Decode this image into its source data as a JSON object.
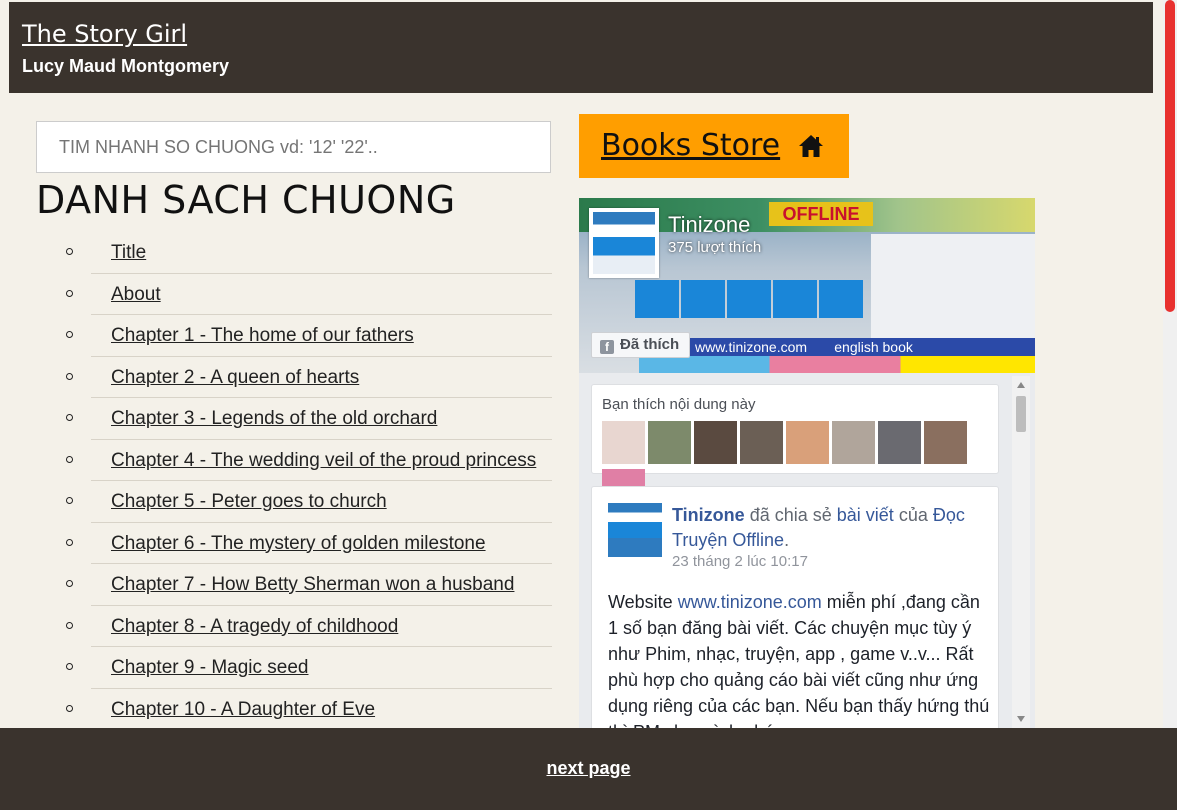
{
  "header": {
    "title": "The Story Girl",
    "author": "Lucy Maud Montgomery"
  },
  "search": {
    "placeholder": "TIM NHANH SO CHUONG vd: '12' '22'.."
  },
  "list": {
    "title": "DANH SACH CHUONG",
    "items": [
      "Title",
      "About",
      "Chapter 1 - The home of our fathers",
      "Chapter 2 - A queen of hearts",
      "Chapter 3 - Legends of the old orchard",
      "Chapter 4 - The wedding veil of the proud princess",
      "Chapter 5 - Peter goes to church",
      "Chapter 6 - The mystery of golden milestone",
      "Chapter 7 - How Betty Sherman won a husband",
      "Chapter 8 - A tragedy of childhood",
      "Chapter 9 - Magic seed",
      "Chapter 10 - A Daughter of Eve"
    ]
  },
  "books_store": {
    "label": "Books Store",
    "icon": "home-icon",
    "color": "#ff9e00"
  },
  "fb": {
    "page_name": "Tinizone",
    "likes": "375 lượt thích",
    "liked_label": "Đã thích",
    "cover_text": {
      "offline": "OFFLINE",
      "band": "www.tinizone.com       english book"
    },
    "friends_label": "Bạn thích nội dung này",
    "friend_colors": [
      "#e8d6d0",
      "#7d8a6b",
      "#5a4a40",
      "#6b5f55",
      "#d9a07a",
      "#b0a59b",
      "#6a6a70",
      "#8a6f5f",
      "#e07fa5"
    ],
    "post": {
      "author": "Tinizone",
      "shared_text": "đã chia sẻ",
      "post_link": "bài viết",
      "of_text": "của",
      "source": "Đọc Truyện Offline",
      "time": "23 tháng 2 lúc 10:17",
      "body_prefix": "Website",
      "body_link": "www.tinizone.com",
      "body_rest": "miễn phí ,đang cần 1 số bạn đăng bài viết. Các chuyện mục tùy ý như Phim, nhạc, truyện, app , game v..v... Rất phù hợp cho quảng cáo bài viết cũng như ứng dụng riêng của các bạn. Nếu bạn thấy hứng thú thì PM cho mình nhé"
    }
  },
  "footer": {
    "next_label": "next page"
  },
  "colors": {
    "header_bg": "#3a332d",
    "page_bg": "#f4f1e9",
    "scroll_accent": "#e8312f"
  }
}
